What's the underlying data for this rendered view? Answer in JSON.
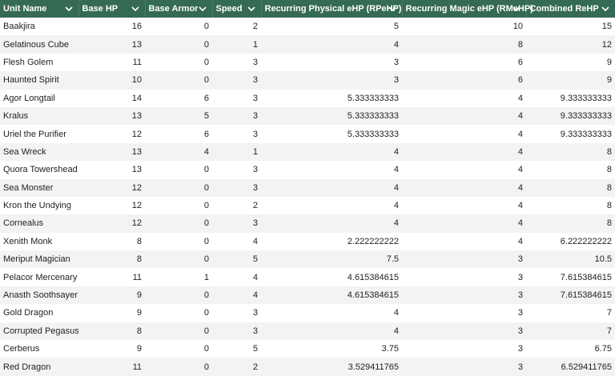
{
  "table": {
    "columns": [
      {
        "label": "Unit Name",
        "align": "left"
      },
      {
        "label": "Base HP",
        "align": "right"
      },
      {
        "label": "Base Armor",
        "align": "right"
      },
      {
        "label": "Speed",
        "align": "right"
      },
      {
        "label": "Recurring Physical eHP (RPeHP)",
        "align": "right"
      },
      {
        "label": "Recurring Magic eHP (RMeHP)",
        "align": "right"
      },
      {
        "label": "Combined ReHP",
        "align": "right"
      }
    ],
    "header_bg": "#356a54",
    "header_icon": "chevron-down-icon",
    "rows": [
      [
        "Baakjira",
        "16",
        "0",
        "2",
        "5",
        "10",
        "15"
      ],
      [
        "Gelatinous Cube",
        "13",
        "0",
        "1",
        "4",
        "8",
        "12"
      ],
      [
        "Flesh Golem",
        "11",
        "0",
        "3",
        "3",
        "6",
        "9"
      ],
      [
        "Haunted Spirit",
        "10",
        "0",
        "3",
        "3",
        "6",
        "9"
      ],
      [
        "Agor Longtail",
        "14",
        "6",
        "3",
        "5.333333333",
        "4",
        "9.333333333"
      ],
      [
        "Kralus",
        "13",
        "5",
        "3",
        "5.333333333",
        "4",
        "9.333333333"
      ],
      [
        "Uriel the Purifier",
        "12",
        "6",
        "3",
        "5.333333333",
        "4",
        "9.333333333"
      ],
      [
        "Sea Wreck",
        "13",
        "4",
        "1",
        "4",
        "4",
        "8"
      ],
      [
        "Quora Towershead",
        "13",
        "0",
        "3",
        "4",
        "4",
        "8"
      ],
      [
        "Sea Monster",
        "12",
        "0",
        "3",
        "4",
        "4",
        "8"
      ],
      [
        "Kron the Undying",
        "12",
        "0",
        "2",
        "4",
        "4",
        "8"
      ],
      [
        "Cornealus",
        "12",
        "0",
        "3",
        "4",
        "4",
        "8"
      ],
      [
        "Xenith Monk",
        "8",
        "0",
        "4",
        "2.222222222",
        "4",
        "6.222222222"
      ],
      [
        "Meriput Magician",
        "8",
        "0",
        "5",
        "7.5",
        "3",
        "10.5"
      ],
      [
        "Pelacor Mercenary",
        "11",
        "1",
        "4",
        "4.615384615",
        "3",
        "7.615384615"
      ],
      [
        "Anasth Soothsayer",
        "9",
        "0",
        "4",
        "4.615384615",
        "3",
        "7.615384615"
      ],
      [
        "Gold Dragon",
        "9",
        "0",
        "3",
        "4",
        "3",
        "7"
      ],
      [
        "Corrupted Pegasus",
        "8",
        "0",
        "3",
        "4",
        "3",
        "7"
      ],
      [
        "Cerberus",
        "9",
        "0",
        "5",
        "3.75",
        "3",
        "6.75"
      ],
      [
        "Red Dragon",
        "11",
        "0",
        "2",
        "3.529411765",
        "3",
        "6.529411765"
      ]
    ]
  }
}
